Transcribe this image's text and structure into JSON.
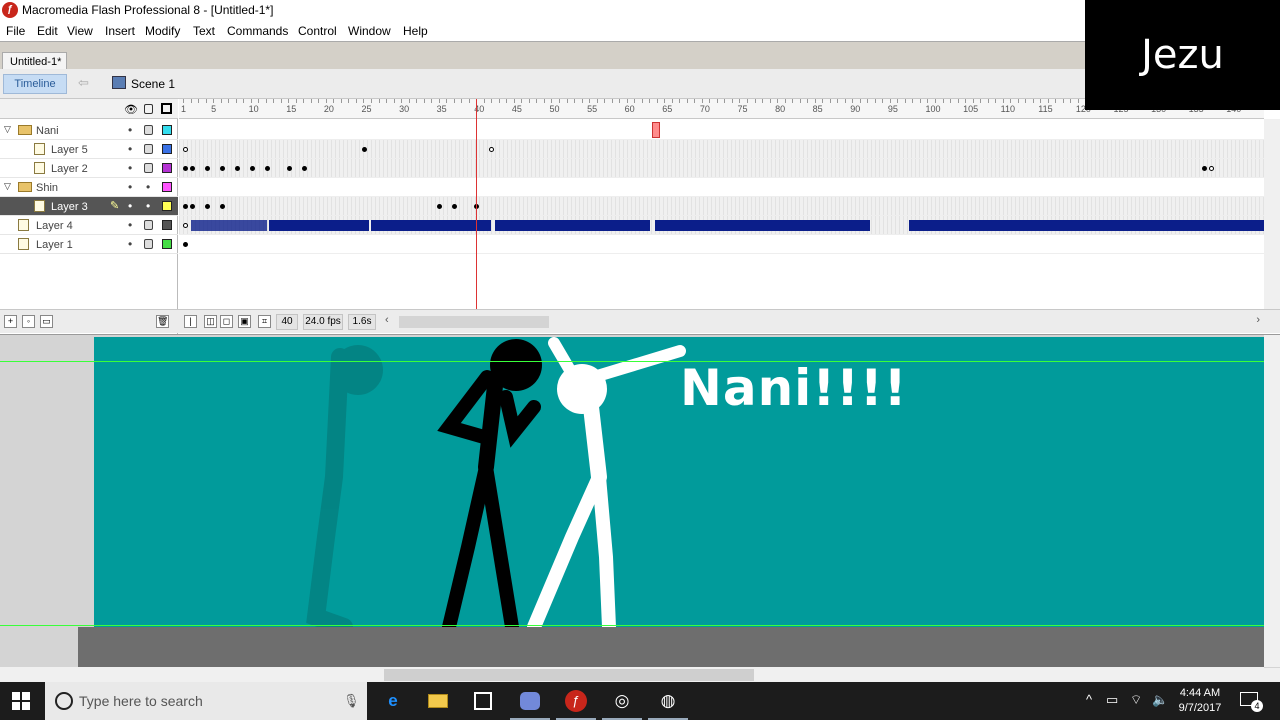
{
  "window": {
    "title": "Macromedia Flash Professional 8 - [Untitled-1*]"
  },
  "menu": [
    "File",
    "Edit",
    "View",
    "Insert",
    "Modify",
    "Text",
    "Commands",
    "Control",
    "Window",
    "Help"
  ],
  "document_tab": "Untitled-1*",
  "timeline_header": {
    "timeline_button": "Timeline",
    "scene": "Scene 1"
  },
  "layers": [
    {
      "name": "Nani",
      "type": "folder",
      "color": "#33ddee"
    },
    {
      "name": "Layer 5",
      "type": "layer",
      "color": "#3a72e6"
    },
    {
      "name": "Layer 2",
      "type": "layer",
      "color": "#b533d4"
    },
    {
      "name": "Shin",
      "type": "folder",
      "color": "#ff55ff"
    },
    {
      "name": "Layer 3",
      "type": "layer",
      "color": "#ffff55",
      "selected": true
    },
    {
      "name": "Layer 4",
      "type": "layer",
      "color": "#555555"
    },
    {
      "name": "Layer 1",
      "type": "layer",
      "color": "#44dd44"
    }
  ],
  "ruler_labels": [
    "1",
    "5",
    "10",
    "15",
    "20",
    "25",
    "30",
    "35",
    "40",
    "45",
    "50",
    "55",
    "60",
    "65",
    "70",
    "75",
    "80",
    "85",
    "90",
    "95",
    "100",
    "105",
    "110",
    "115",
    "120",
    "125",
    "130",
    "135",
    "140"
  ],
  "timeline_status": {
    "current_frame": "40",
    "frame_rate": "24.0 fps",
    "elapsed": "1.6s"
  },
  "stage": {
    "caption": "Nani!!!!",
    "background_color": "#019b9b"
  },
  "watermark": "Jezu",
  "taskbar": {
    "search_placeholder": "Type here to search",
    "time": "4:44 AM",
    "date": "9/7/2017",
    "notifications": "4"
  }
}
